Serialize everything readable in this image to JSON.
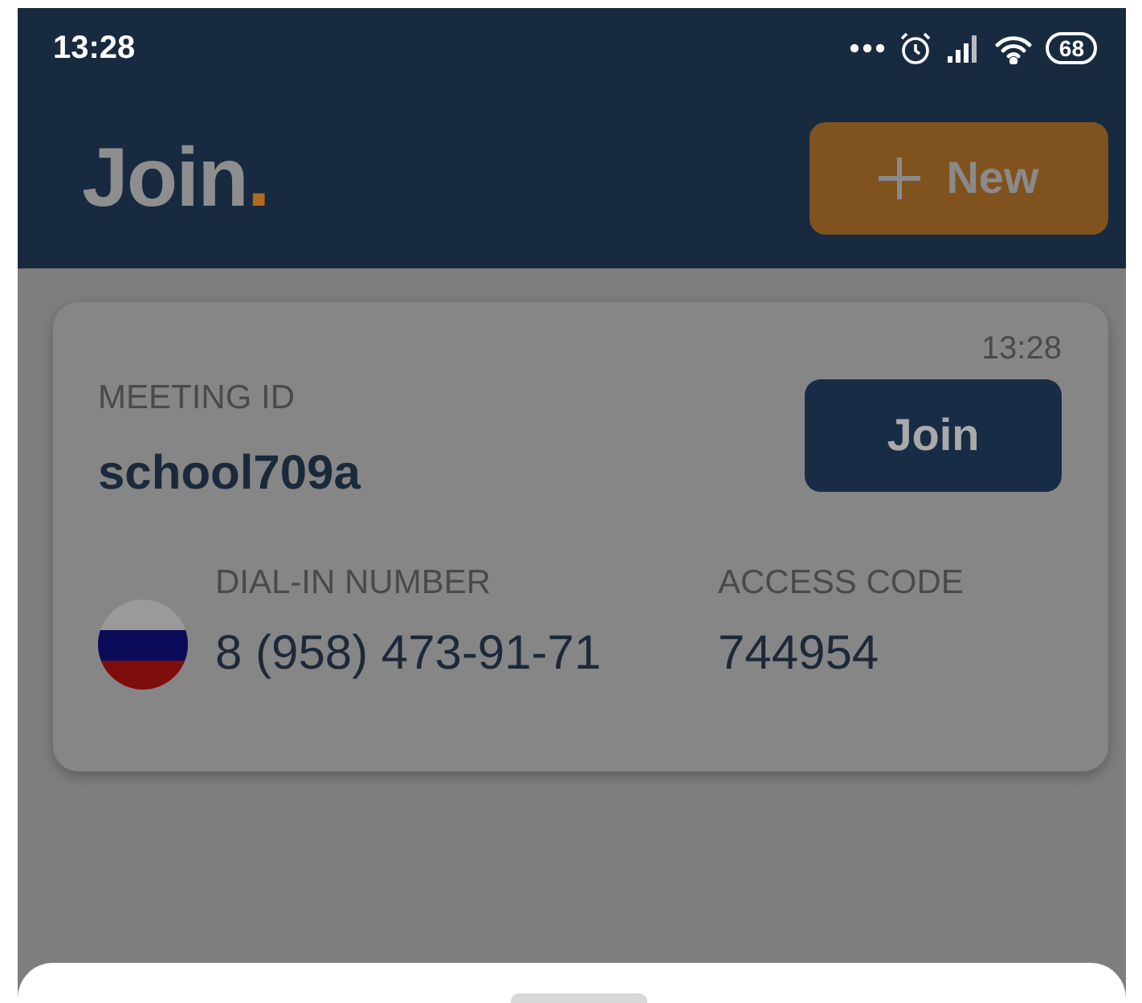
{
  "status_bar": {
    "time": "13:28",
    "battery": "68"
  },
  "header": {
    "logo": "Join",
    "logo_dot": ".",
    "new_button": "New"
  },
  "meeting_card": {
    "time": "13:28",
    "meeting_id_label": "MEETING ID",
    "meeting_id": "school709a",
    "join_button": "Join",
    "dial_in_label": "DIAL-IN NUMBER",
    "dial_in_number": "8 (958) 473-91-71",
    "access_code_label": "ACCESS CODE",
    "access_code": "744954"
  }
}
